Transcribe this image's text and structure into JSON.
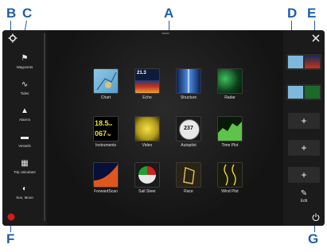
{
  "callouts": {
    "a": "A",
    "b": "B",
    "c": "C",
    "d": "D",
    "e": "E",
    "f": "F",
    "g": "G"
  },
  "sidebar": {
    "items": [
      {
        "label": "Waypoints",
        "icon": "flag-icon"
      },
      {
        "label": "Tides",
        "icon": "tide-wave-icon"
      },
      {
        "label": "Alarms",
        "icon": "bell-icon"
      },
      {
        "label": "Vessels",
        "icon": "vessel-icon"
      },
      {
        "label": "Trip calculator",
        "icon": "calculator-icon"
      },
      {
        "label": "Sun, Moon",
        "icon": "moon-icon"
      }
    ]
  },
  "apps": [
    {
      "label": "Chart"
    },
    {
      "label": "Echo"
    },
    {
      "label": "Structure"
    },
    {
      "label": "Radar"
    },
    {
      "label": "Instruments",
      "value1": "18.5",
      "unit1": "kn",
      "value2": "067",
      "unit2": "°M"
    },
    {
      "label": "Video"
    },
    {
      "label": "Autopilot",
      "readout": "237"
    },
    {
      "label": "Time Plot"
    },
    {
      "label": "ForwardScan"
    },
    {
      "label": "Sail Steer"
    },
    {
      "label": "Race"
    },
    {
      "label": "Wind Plot"
    }
  ],
  "echo_depth": "21.3",
  "right": {
    "add_label": "+",
    "edit_label": "Edit"
  },
  "colors": {
    "callout": "#1f5fa8",
    "panel": "#1b1b1b",
    "screen": "#0c0c0c"
  }
}
